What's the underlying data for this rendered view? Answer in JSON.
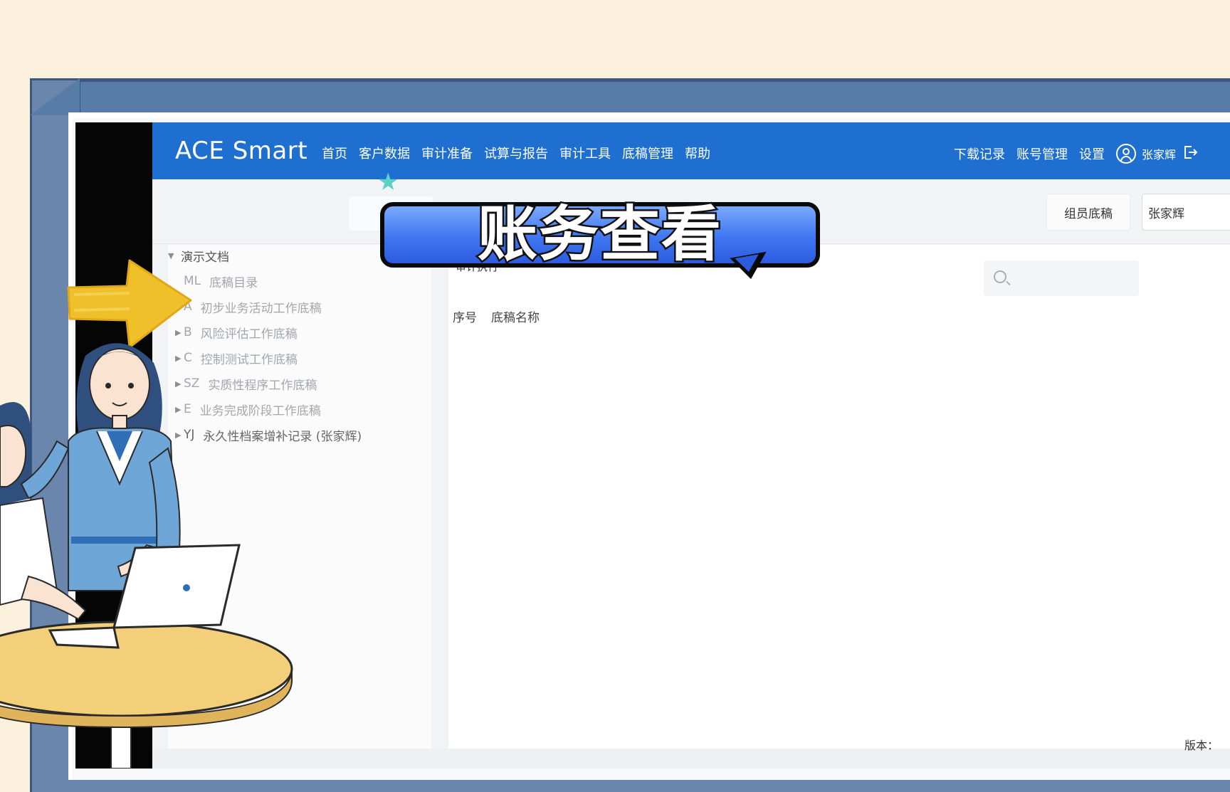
{
  "app": {
    "brand": "ACE Smart",
    "main_nav": [
      "首页",
      "客户数据",
      "审计准备",
      "试算与报告",
      "审计工具",
      "底稿管理",
      "帮助"
    ],
    "right_nav": {
      "download_records": "下载记录",
      "account_manage": "账号管理",
      "settings": "设置",
      "user_name": "张家辉"
    },
    "toolbar": {
      "member_button": "组员底稿",
      "user_select_value": "张家辉"
    },
    "tree": {
      "root": "演示文档",
      "items": [
        {
          "code": "ML",
          "label": "底稿目录",
          "expandable": false
        },
        {
          "code": "A",
          "label": "初步业务活动工作底稿",
          "expandable": false
        },
        {
          "code": "B",
          "label": "风险评估工作底稿",
          "expandable": true
        },
        {
          "code": "C",
          "label": "控制测试工作底稿",
          "expandable": true
        },
        {
          "code": "SZ",
          "label": "实质性程序工作底稿",
          "expandable": true
        },
        {
          "code": "E",
          "label": "业务完成阶段工作底稿",
          "expandable": true
        },
        {
          "code": "YJ",
          "label": "永久性档案增补记录 (张家辉)",
          "expandable": true
        }
      ]
    },
    "content": {
      "title": "审计执行",
      "columns": [
        "序号",
        "底稿名称"
      ]
    },
    "footer": {
      "version_label": "版本："
    }
  },
  "overlay": {
    "caption": "账务查看"
  },
  "colors": {
    "topbar": "#1f6fd0",
    "page_bg": "#fcf1dc",
    "frame": "#6a86ad",
    "caption_bubble": "#3f76f0",
    "arrow": "#f0c02a"
  }
}
